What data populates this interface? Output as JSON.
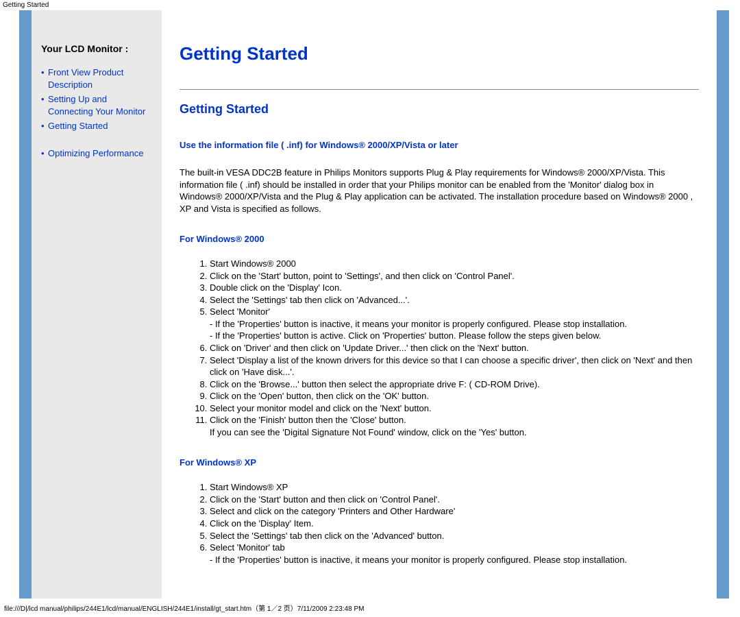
{
  "browser_header": "Getting Started",
  "sidebar": {
    "title": "Your LCD Monitor :",
    "items": [
      {
        "label": "Front View Product Description"
      },
      {
        "label": "Setting Up and Connecting Your Monitor"
      },
      {
        "label": "Getting Started"
      },
      {
        "label": "Optimizing Performance"
      }
    ]
  },
  "content": {
    "title": "Getting Started",
    "subtitle": "Getting Started",
    "sub_sub": "Use the information file ( .inf) for Windows® 2000/XP/Vista or later",
    "intro": "The built-in VESA DDC2B feature in Philips Monitors supports Plug & Play requirements for Windows® 2000/XP/Vista. This information file ( .inf) should be installed in order that your Philips monitor can be enabled from the 'Monitor' dialog box in Windows® 2000/XP/Vista and the Plug & Play application can be activated. The installation procedure based on Windows® 2000 , XP and Vista is specified as follows.",
    "win2000": {
      "heading": "For Windows® 2000",
      "steps": [
        "Start Windows® 2000",
        "Click on the 'Start' button, point to 'Settings', and then click on 'Control Panel'.",
        "Double click on the 'Display' Icon.",
        "Select the 'Settings' tab then click on 'Advanced...'.",
        "Select 'Monitor'\n- If the 'Properties' button is inactive, it means your monitor is properly configured. Please stop installation.\n- If the 'Properties' button is active. Click on 'Properties' button. Please follow the steps given below.",
        "Click on 'Driver' and then click on 'Update Driver...' then click on the 'Next' button.",
        "Select 'Display a list of the known drivers for this device so that I can choose a specific driver', then click on 'Next' and then click on 'Have disk...'.",
        "Click on the 'Browse...' button then select the appropriate drive F: ( CD-ROM Drive).",
        "Click on the 'Open' button, then click on the 'OK' button.",
        "Select your monitor model and click on the 'Next' button.",
        "Click on the 'Finish' button then the 'Close' button.\nIf you can see the 'Digital Signature Not Found' window, click on the 'Yes' button."
      ]
    },
    "winxp": {
      "heading": "For Windows® XP",
      "steps": [
        "Start Windows® XP",
        "Click on the 'Start' button and then click on 'Control Panel'.",
        "Select and click on the category 'Printers and Other Hardware'",
        "Click on the 'Display' Item.",
        "Select the 'Settings' tab then click on the 'Advanced' button.",
        "Select 'Monitor' tab\n- If the 'Properties' button is inactive, it means your monitor is properly configured. Please stop installation."
      ]
    }
  },
  "footer": "file:///D|/lcd manual/philips/244E1/lcd/manual/ENGLISH/244E1/install/gt_start.htm（第 1／2 页）7/11/2009 2:23:48 PM"
}
